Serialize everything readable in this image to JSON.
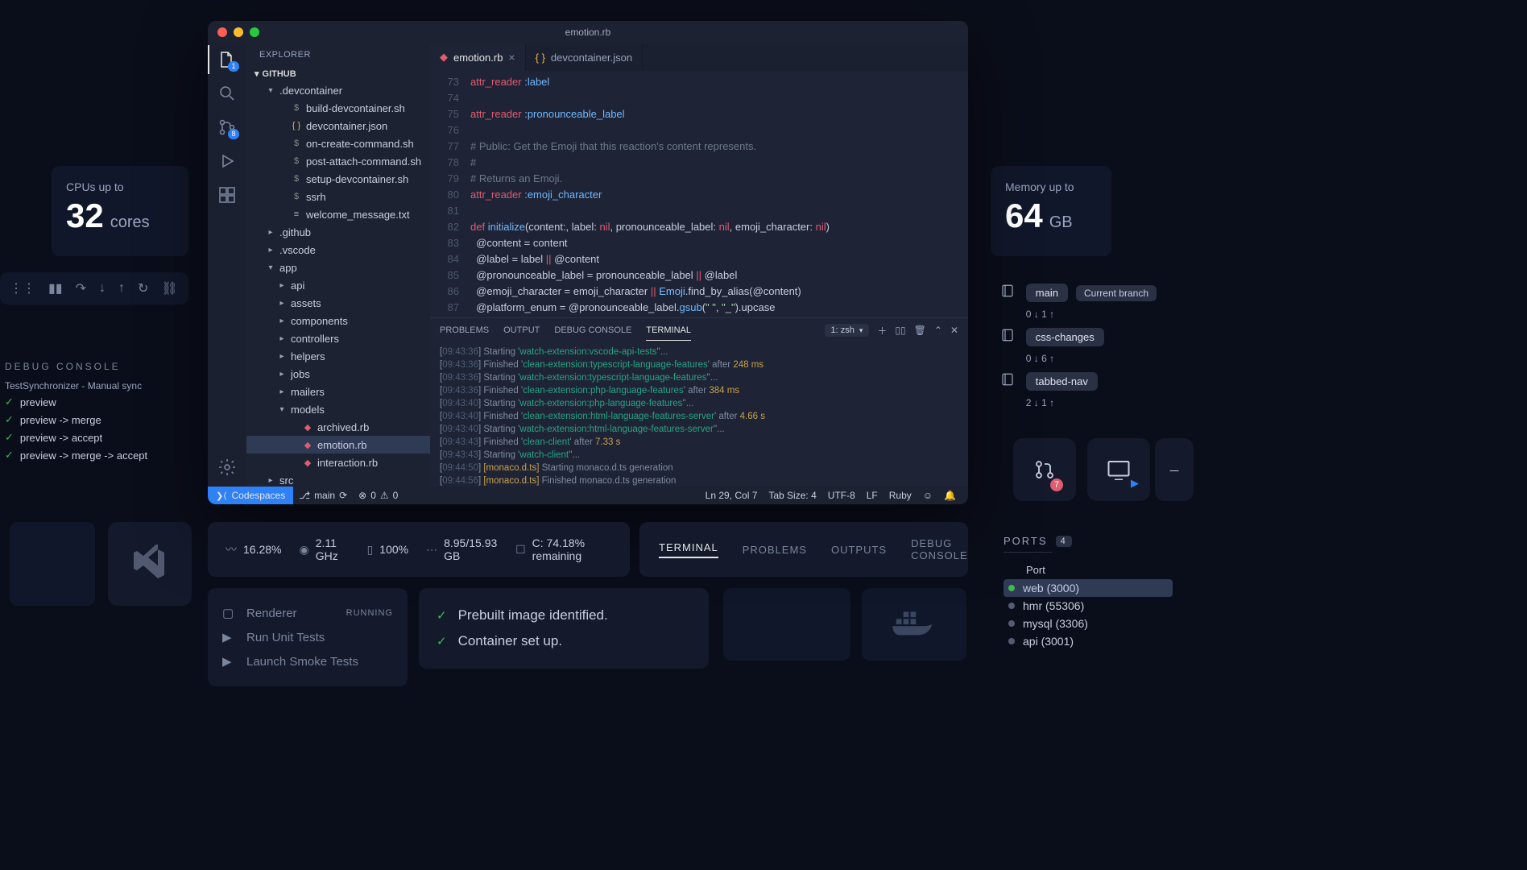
{
  "backdrop": {
    "cpu_label": "CPUs up to",
    "cpu_value": "32",
    "cpu_unit": "cores",
    "mem_label": "Memory up to",
    "mem_value": "64",
    "mem_unit": "GB"
  },
  "window_title": "emotion.rb",
  "activity_badges": {
    "explorer": "1",
    "scm": "8"
  },
  "explorer": {
    "title": "EXPLORER",
    "root": "GITHUB",
    "tree": [
      {
        "d": 1,
        "t": "folder",
        "open": true,
        "name": ".devcontainer"
      },
      {
        "d": 2,
        "t": "file",
        "icon": "sh",
        "name": "build-devcontainer.sh"
      },
      {
        "d": 2,
        "t": "file",
        "icon": "json",
        "name": "devcontainer.json"
      },
      {
        "d": 2,
        "t": "file",
        "icon": "sh",
        "name": "on-create-command.sh"
      },
      {
        "d": 2,
        "t": "file",
        "icon": "sh",
        "name": "post-attach-command.sh"
      },
      {
        "d": 2,
        "t": "file",
        "icon": "sh",
        "name": "setup-devcontainer.sh"
      },
      {
        "d": 2,
        "t": "file",
        "icon": "sh",
        "name": "ssrh"
      },
      {
        "d": 2,
        "t": "file",
        "icon": "txt",
        "name": "welcome_message.txt"
      },
      {
        "d": 1,
        "t": "folder",
        "open": false,
        "name": ".github"
      },
      {
        "d": 1,
        "t": "folder",
        "open": false,
        "name": ".vscode"
      },
      {
        "d": 1,
        "t": "folder",
        "open": true,
        "name": "app"
      },
      {
        "d": 2,
        "t": "folder",
        "open": false,
        "name": "api"
      },
      {
        "d": 2,
        "t": "folder",
        "open": false,
        "name": "assets"
      },
      {
        "d": 2,
        "t": "folder",
        "open": false,
        "name": "components"
      },
      {
        "d": 2,
        "t": "folder",
        "open": false,
        "name": "controllers"
      },
      {
        "d": 2,
        "t": "folder",
        "open": false,
        "name": "helpers"
      },
      {
        "d": 2,
        "t": "folder",
        "open": false,
        "name": "jobs"
      },
      {
        "d": 2,
        "t": "folder",
        "open": false,
        "name": "mailers"
      },
      {
        "d": 2,
        "t": "folder",
        "open": true,
        "name": "models"
      },
      {
        "d": 3,
        "t": "file",
        "icon": "rb",
        "name": "archived.rb"
      },
      {
        "d": 3,
        "t": "file",
        "icon": "rb",
        "name": "emotion.rb",
        "sel": true
      },
      {
        "d": 3,
        "t": "file",
        "icon": "rb",
        "name": "interaction.rb"
      },
      {
        "d": 1,
        "t": "folder",
        "open": false,
        "name": "src"
      }
    ]
  },
  "tabs": [
    {
      "icon": "rb",
      "label": "emotion.rb",
      "active": true,
      "close": true
    },
    {
      "icon": "json",
      "label": "devcontainer.json",
      "active": false,
      "close": false
    }
  ],
  "code": [
    {
      "n": 73,
      "h": "<span class='kw'>attr_reader</span> <span class='sym'>:label</span>"
    },
    {
      "n": 74,
      "h": ""
    },
    {
      "n": 75,
      "h": "<span class='kw'>attr_reader</span> <span class='sym'>:pronounceable_label</span>"
    },
    {
      "n": 76,
      "h": ""
    },
    {
      "n": 77,
      "h": "<span class='cm'># Public: Get the Emoji that this reaction's content represents.</span>"
    },
    {
      "n": 78,
      "h": "<span class='cm'>#</span>"
    },
    {
      "n": 79,
      "h": "<span class='cm'># Returns an Emoji.</span>"
    },
    {
      "n": 80,
      "h": "<span class='kw'>attr_reader</span> <span class='sym'>:emoji_character</span>"
    },
    {
      "n": 81,
      "h": ""
    },
    {
      "n": 82,
      "h": "<span class='kw'>def</span> <span class='fn'>initialize</span><span class='pn'>(content:, label: </span><span class='kw'>nil</span><span class='pn'>, pronounceable_label: </span><span class='kw'>nil</span><span class='pn'>, emoji_character: </span><span class='kw'>nil</span><span class='pn'>)</span>"
    },
    {
      "n": 83,
      "h": "  <span class='pn'>@content = content</span>"
    },
    {
      "n": 84,
      "h": "  <span class='pn'>@label = label </span><span class='op'>||</span><span class='pn'> @content</span>"
    },
    {
      "n": 85,
      "h": "  <span class='pn'>@pronounceable_label = pronounceable_label </span><span class='op'>||</span><span class='pn'> @label</span>"
    },
    {
      "n": 86,
      "h": "  <span class='pn'>@emoji_character = emoji_character </span><span class='op'>||</span><span class='pn'> </span><span class='cls'>Emoji</span><span class='pn'>.find_by_alias(@content)</span>"
    },
    {
      "n": 87,
      "h": "  <span class='pn'>@platform_enum = @pronounceable_label.</span><span class='fn'>gsub</span><span class='pn'>(</span><span class='str'>\" \"</span><span class='pn'>, </span><span class='str'>\"_\"</span><span class='pn'>).upcase</span>"
    },
    {
      "n": 88,
      "h": ""
    }
  ],
  "panel_tabs": [
    "PROBLEMS",
    "OUTPUT",
    "DEBUG CONSOLE",
    "TERMINAL"
  ],
  "panel_active": 3,
  "term_select": "1: zsh",
  "terminal": [
    {
      "ts": "09:43:36",
      "txt": "Starting ",
      "task": "watch-extension:vscode-api-tests",
      "after": "",
      "dur": "",
      "tail": "'..."
    },
    {
      "ts": "09:43:36",
      "txt": "Finished ",
      "task": "clean-extension:typescript-language-features",
      "after": " after ",
      "dur": "248 ms",
      "tail": ""
    },
    {
      "ts": "09:43:36",
      "txt": "Starting ",
      "task": "watch-extension:typescript-language-features",
      "after": "",
      "dur": "",
      "tail": "'..."
    },
    {
      "ts": "09:43:36",
      "txt": "Finished ",
      "task": "clean-extension:php-language-features",
      "after": " after ",
      "dur": "384 ms",
      "tail": ""
    },
    {
      "ts": "09:43:40",
      "txt": "Starting ",
      "task": "watch-extension:php-language-features",
      "after": "",
      "dur": "",
      "tail": "'..."
    },
    {
      "ts": "09:43:40",
      "txt": "Finished ",
      "task": "clean-extension:html-language-features-server",
      "after": " after ",
      "dur": "4.66 s",
      "tail": ""
    },
    {
      "ts": "09:43:40",
      "txt": "Starting ",
      "task": "watch-extension:html-language-features-server",
      "after": "",
      "dur": "",
      "tail": "'..."
    },
    {
      "ts": "09:43:43",
      "txt": "Finished ",
      "task": "clean-client",
      "after": " after ",
      "dur": "7.33 s",
      "tail": ""
    },
    {
      "ts": "09:43:43",
      "txt": "Starting ",
      "task": "watch-client",
      "after": "",
      "dur": "",
      "tail": "'..."
    },
    {
      "ts": "09:44:50",
      "mon": "[monaco.d.ts]",
      "txt2": " Starting monaco.d.ts generation"
    },
    {
      "ts": "09:44:56",
      "mon": "[monaco.d.ts]",
      "txt2": " Finished monaco.d.ts generation"
    }
  ],
  "status": {
    "codespaces": "Codespaces",
    "branch": "main",
    "errors": "0",
    "warnings": "0",
    "cursor": "Ln 29, Col 7",
    "tabsize": "Tab Size: 4",
    "encoding": "UTF-8",
    "eol": "LF",
    "lang": "Ruby"
  },
  "debug_console": {
    "title": "DEBUG CONSOLE",
    "line": "TestSynchronizer - Manual sync",
    "items": [
      "preview",
      "preview -> merge",
      "preview -> accept",
      "preview -> merge -> accept"
    ]
  },
  "branches": [
    {
      "name": "main",
      "current": "Current branch",
      "sync": "0 ↓ 1 ↑"
    },
    {
      "name": "css-changes",
      "sync": "0 ↓ 6 ↑"
    },
    {
      "name": "tabbed-nav",
      "sync": "2 ↓ 1 ↑"
    }
  ],
  "stats": {
    "cpu": "16.28%",
    "clock": "2.11 GHz",
    "batt": "100%",
    "mem": "8.95/15.93 GB",
    "disk": "C: 74.18% remaining"
  },
  "pswitch": [
    "TERMINAL",
    "PROBLEMS",
    "OUTPUTS",
    "DEBUG CONSOLE"
  ],
  "tasks": [
    {
      "icon": "▢",
      "label": "Renderer",
      "status": "RUNNING"
    },
    {
      "icon": "▶",
      "label": "Run Unit Tests"
    },
    {
      "icon": "▶",
      "label": "Launch Smoke Tests"
    }
  ],
  "steps": [
    "Prebuilt image identified.",
    "Container set up."
  ],
  "ports": {
    "title": "PORTS",
    "count": "4",
    "col": "Port",
    "rows": [
      {
        "on": true,
        "name": "web (3000)",
        "sel": true
      },
      {
        "on": false,
        "name": "hmr (55306)"
      },
      {
        "on": false,
        "name": "mysql (3306)"
      },
      {
        "on": false,
        "name": "api (3001)"
      }
    ]
  },
  "sq_badge": "7"
}
